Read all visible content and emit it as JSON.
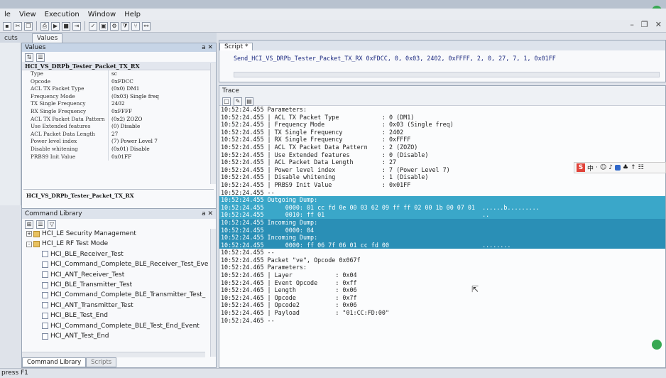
{
  "menu": [
    "le",
    "View",
    "Execution",
    "Window",
    "Help"
  ],
  "left_tabs": [
    "cuts",
    "Values"
  ],
  "values_panel": {
    "title": "Values",
    "group": "HCI_VS_DRPb_Tester_Packet_TX_RX",
    "rows": [
      {
        "key": "Type",
        "value": "sc"
      },
      {
        "key": "Opcode",
        "value": "0xFDCC"
      },
      {
        "key": "ACL TX Packet Type",
        "value": "(0x0) DM1"
      },
      {
        "key": "Frequency Mode",
        "value": "(0x03) Single freq"
      },
      {
        "key": "TX Single Frequency",
        "value": "2402"
      },
      {
        "key": "RX Single Frequency",
        "value": "0xFFFF"
      },
      {
        "key": "ACL TX Packet Data Pattern",
        "value": "(0x2) ZOZO"
      },
      {
        "key": "Use Extended features",
        "value": "(0) Disable"
      },
      {
        "key": "ACL Packet Data Length",
        "value": "27"
      },
      {
        "key": "Power level index",
        "value": "(7) Power Level 7"
      },
      {
        "key": "Disable whitening",
        "value": "(0x01) Disable"
      },
      {
        "key": "PRBS9 Init Value",
        "value": "0x01FF"
      }
    ],
    "description": "HCI_VS_DRPb_Tester_Packet_TX_RX"
  },
  "command_library": {
    "title": "Command Library",
    "items": [
      {
        "label": "HCI_LE Security Management",
        "kind": "folder",
        "expander": "+",
        "indent": 0
      },
      {
        "label": "HCI_LE RF Test Mode",
        "kind": "folder",
        "expander": "-",
        "indent": 0
      },
      {
        "label": "HCI_BLE_Receiver_Test",
        "kind": "cmd",
        "indent": 1
      },
      {
        "label": "HCI_Command_Complete_BLE_Receiver_Test_Eve",
        "kind": "cmd",
        "indent": 1
      },
      {
        "label": "HCI_ANT_Receiver_Test",
        "kind": "cmd",
        "indent": 1
      },
      {
        "label": "HCI_BLE_Transmitter_Test",
        "kind": "cmd",
        "indent": 1
      },
      {
        "label": "HCI_Command_Complete_BLE_Transmitter_Test_",
        "kind": "cmd",
        "indent": 1
      },
      {
        "label": "HCI_ANT_Transmitter_Test",
        "kind": "cmd",
        "indent": 1
      },
      {
        "label": "HCI_BLE_Test_End",
        "kind": "cmd",
        "indent": 1
      },
      {
        "label": "HCI_Command_Complete_BLE_Test_End_Event",
        "kind": "cmd",
        "indent": 1
      },
      {
        "label": "HCI_ANT_Test_End",
        "kind": "cmd",
        "indent": 1
      }
    ],
    "tabs": [
      "Command Library",
      "Scripts"
    ]
  },
  "script": {
    "tab": "Script *",
    "line": "Send_HCI_VS_DRPb_Tester_Packet_TX_RX 0xFDCC, 0, 0x03, 2402, 0xFFFF, 2, 0, 27, 7, 1, 0x01FF"
  },
  "trace": {
    "title": "Trace",
    "lines": [
      {
        "text": "10:52:24.455 Parameters:",
        "hl": ""
      },
      {
        "text": "10:52:24.455 | ACL TX Packet Type            : 0 (DM1)",
        "hl": ""
      },
      {
        "text": "10:52:24.455 | Frequency Mode                : 0x03 (Single freq)",
        "hl": ""
      },
      {
        "text": "10:52:24.455 | TX Single Frequency           : 2402",
        "hl": ""
      },
      {
        "text": "10:52:24.455 | RX Single Frequency           : 0xFFFF",
        "hl": ""
      },
      {
        "text": "10:52:24.455 | ACL TX Packet Data Pattern    : 2 (ZOZO)",
        "hl": ""
      },
      {
        "text": "10:52:24.455 | Use Extended features         : 0 (Disable)",
        "hl": ""
      },
      {
        "text": "10:52:24.455 | ACL Packet Data Length        : 27",
        "hl": ""
      },
      {
        "text": "10:52:24.455 | Power level index             : 7 (Power Level 7)",
        "hl": ""
      },
      {
        "text": "10:52:24.455 | Disable whitening             : 1 (Disable)",
        "hl": ""
      },
      {
        "text": "10:52:24.455 | PRBS9 Init Value              : 0x01FF",
        "hl": ""
      },
      {
        "text": "10:52:24.455 --",
        "hl": ""
      },
      {
        "text": "10:52:24.455 Outgoing Dump:",
        "hl": "hl"
      },
      {
        "text": "10:52:24.455      0000: 01 cc fd 0e 00 03 62 09 ff ff 02 00 1b 00 07 01  ......b.........",
        "hl": "hl"
      },
      {
        "text": "10:52:24.455      0010: ff 01                                            ..",
        "hl": "hl"
      },
      {
        "text": "10:52:24.455 Incoming Dump:",
        "hl": "hl2"
      },
      {
        "text": "10:52:24.455      0000: 04",
        "hl": "hl2"
      },
      {
        "text": "10:52:24.455 Incoming Dump:",
        "hl": "hl2"
      },
      {
        "text": "10:52:24.455      0000: ff 06 7f 06 01 cc fd 00                          ........",
        "hl": "hl2"
      },
      {
        "text": "10:52:24.455 --",
        "hl": ""
      },
      {
        "text": "10:52:24.455 Packet \"ve\", Opcode 0x067f",
        "hl": ""
      },
      {
        "text": "10:52:24.465 Parameters:",
        "hl": ""
      },
      {
        "text": "10:52:24.465 | Layer            : 0x04",
        "hl": ""
      },
      {
        "text": "10:52:24.465 | Event Opcode     : 0xff",
        "hl": ""
      },
      {
        "text": "10:52:24.465 | Length           : 0x06",
        "hl": ""
      },
      {
        "text": "10:52:24.465 | Opcode           : 0x7f",
        "hl": ""
      },
      {
        "text": "10:52:24.465 | Opcode2          : 0x06",
        "hl": ""
      },
      {
        "text": "10:52:24.465 | Payload          : \"01:CC:FD:00\"",
        "hl": ""
      },
      {
        "text": "10:52:24.465 --",
        "hl": ""
      }
    ]
  },
  "ime": {
    "logo": "S",
    "label": "中"
  },
  "status": "press F1",
  "colors": {
    "highlight": "#3aa7c9",
    "highlight_dark": "#2a8fb6",
    "ime_logo": "#e0433a"
  }
}
